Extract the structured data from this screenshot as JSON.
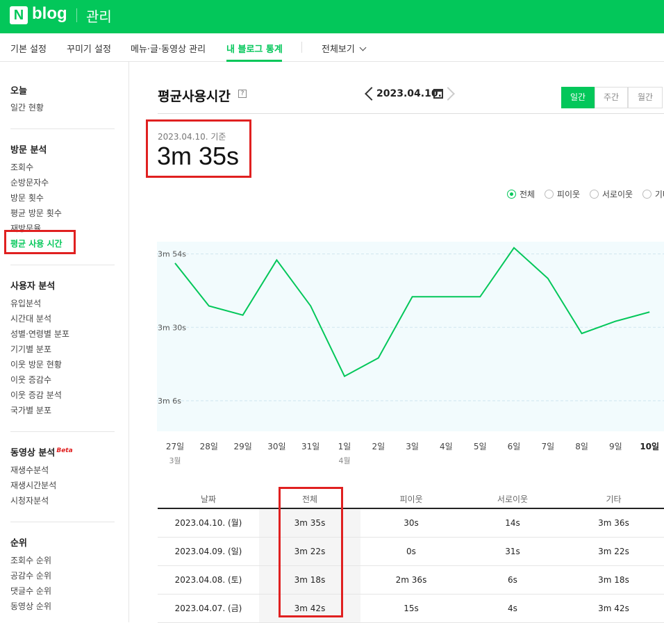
{
  "header": {
    "logo_n": "N",
    "logo_blog": "blog",
    "section": "관리"
  },
  "tabs": [
    "기본 설정",
    "꾸미기 설정",
    "메뉴·글·동영상 관리",
    "내 블로그 통계",
    "전체보기"
  ],
  "sidebar": {
    "today_head": "오늘",
    "today_items": [
      "일간 현황"
    ],
    "visit_head": "방문 분석",
    "visit_items": [
      "조회수",
      "순방문자수",
      "방문 횟수",
      "평균 방문 횟수",
      "재방문율",
      "평균 사용 시간"
    ],
    "user_head": "사용자 분석",
    "user_items": [
      "유입분석",
      "시간대 분석",
      "성별·연령별 분포",
      "기기별 분포",
      "이웃 방문 현황",
      "이웃 증감수",
      "이웃 증감 분석",
      "국가별 분포"
    ],
    "video_head": "동영상 분석",
    "video_beta": "Beta",
    "video_items": [
      "재생수분석",
      "재생시간분석",
      "시청자분석"
    ],
    "rank_head": "순위",
    "rank_items": [
      "조회수 순위",
      "공감수 순위",
      "댓글수 순위",
      "동영상 순위"
    ]
  },
  "main": {
    "title": "평균사용시간",
    "help": "?",
    "date": "2023.04.10.",
    "periods": [
      "일간",
      "주간",
      "월간"
    ],
    "basis": "2023.04.10. 기준",
    "value": "3m 35s",
    "filters": [
      "전체",
      "피이웃",
      "서로이웃",
      "기타"
    ]
  },
  "chart_data": {
    "type": "line",
    "categories": [
      "27일",
      "28일",
      "29일",
      "30일",
      "31일",
      "1일",
      "2일",
      "3일",
      "4일",
      "5일",
      "6일",
      "7일",
      "8일",
      "9일",
      "10일"
    ],
    "month_labels": {
      "0": "3월",
      "5": "4월"
    },
    "series": [
      {
        "name": "전체",
        "color": "#03c75a",
        "values": [
          231,
          217,
          214,
          232,
          217,
          194,
          200,
          220,
          220,
          220,
          236,
          226,
          208,
          212,
          215
        ]
      }
    ],
    "y_ticks": [
      {
        "value": 234,
        "label": "3m 54s"
      },
      {
        "value": 210,
        "label": "3m 30s"
      },
      {
        "value": 186,
        "label": "3m 6s"
      }
    ],
    "ylim": [
      176,
      238
    ],
    "ylabel": "",
    "xlabel": ""
  },
  "table": {
    "headers": [
      "날짜",
      "전체",
      "피이웃",
      "서로이웃",
      "기타"
    ],
    "rows": [
      [
        "2023.04.10. (월)",
        "3m 35s",
        "30s",
        "14s",
        "3m 36s"
      ],
      [
        "2023.04.09. (일)",
        "3m 22s",
        "0s",
        "31s",
        "3m 22s"
      ],
      [
        "2023.04.08. (토)",
        "3m 18s",
        "2m 36s",
        "6s",
        "3m 18s"
      ],
      [
        "2023.04.07. (금)",
        "3m 42s",
        "15s",
        "4s",
        "3m 42s"
      ]
    ]
  }
}
